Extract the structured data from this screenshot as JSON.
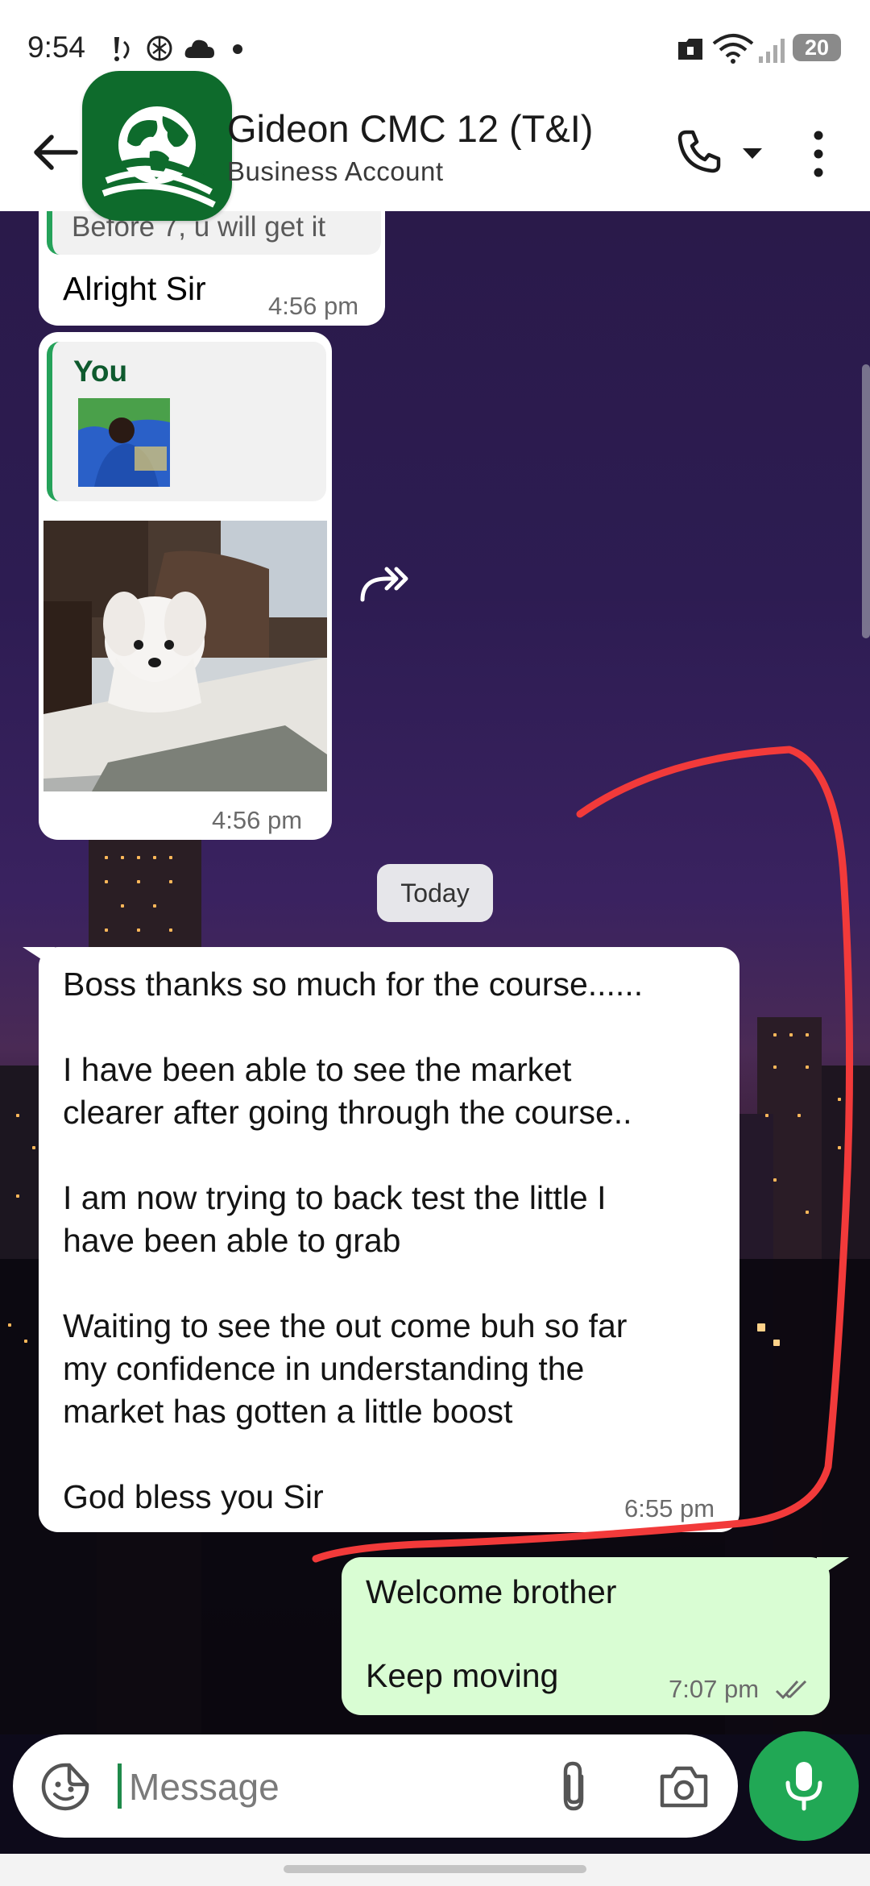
{
  "status_bar": {
    "time": "9:54",
    "battery": "20",
    "icons": [
      "notification-icon",
      "chatgpt-icon",
      "cloud-icon",
      "dot-icon",
      "vpn-icon",
      "wifi-icon",
      "signal-icon",
      "battery-icon"
    ]
  },
  "header": {
    "contact_name": "Gideon CMC 12 (T&I)",
    "subtitle": "Business Account",
    "icons": [
      "back-arrow-icon",
      "avatar-globe-logo",
      "phone-icon",
      "dropdown-icon",
      "more-vert-icon"
    ]
  },
  "messages": {
    "m1": {
      "quoted_text": "Before 7, u will get it",
      "text": "Alright Sir",
      "time": "4:56 pm"
    },
    "m2": {
      "reply_author": "You",
      "time": "4:56 pm",
      "image": "white puppy peeking over a table"
    },
    "date_divider": "Today",
    "m3": {
      "paragraphs": [
        "Boss thanks so much for the course......",
        "I have been able to see the market",
        "clearer after going through the course..",
        "I am now trying to back test the  little I",
        "have been able to grab",
        "Waiting to see the out come buh so far",
        "my confidence in understanding the",
        "market has gotten a little boost",
        "God bless you Sir"
      ],
      "time": "6:55 pm"
    },
    "m4": {
      "line1": "Welcome brother",
      "line2": "Keep moving",
      "time": "7:07 pm",
      "status": "read"
    }
  },
  "composer": {
    "placeholder": "Message",
    "icons": [
      "sticker-icon",
      "attach-icon",
      "camera-icon",
      "mic-icon"
    ]
  },
  "colors": {
    "incoming_bubble": "#ffffff",
    "outgoing_bubble": "#d9fdd3",
    "accent": "#21a855",
    "annotation_stroke": "#f23a3a",
    "avatar_bg": "#0e6b2c"
  }
}
